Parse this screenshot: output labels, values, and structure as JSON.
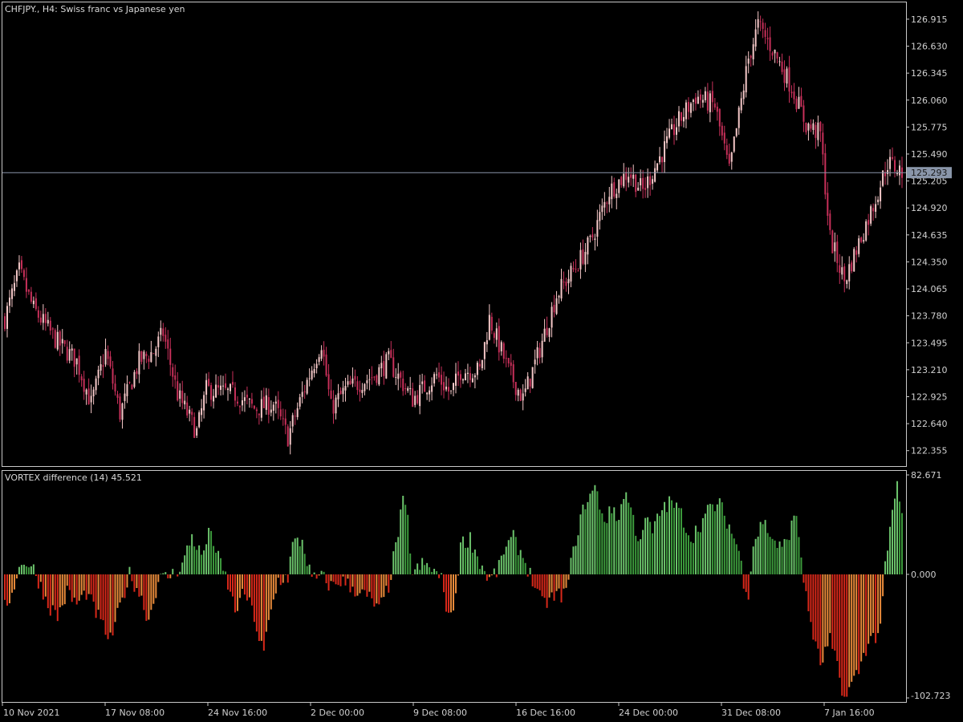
{
  "main_chart": {
    "title": "CHFJPY., H4:  Swiss franc vs Japanese yen",
    "current_price_label": "125.293",
    "current_price": 125.293,
    "price_ticks": [
      "126.915",
      "126.630",
      "126.345",
      "126.060",
      "125.775",
      "125.490",
      "125.205",
      "124.920",
      "124.635",
      "124.350",
      "124.065",
      "123.780",
      "123.495",
      "123.210",
      "122.925",
      "122.640",
      "122.355"
    ]
  },
  "indicator": {
    "title": "VORTEX difference (14) 45.521",
    "ticks": [
      "82.671",
      "0.000",
      "-102.723"
    ]
  },
  "time_axis": {
    "labels": [
      "10 Nov 2021",
      "17 Nov 08:00",
      "24 Nov 16:00",
      "2 Dec 00:00",
      "9 Dec 08:00",
      "16 Dec 16:00",
      "24 Dec 00:00",
      "31 Dec 08:00",
      "7 Jan 16:00"
    ]
  },
  "colors": {
    "background": "#000000",
    "frame": "#c8c8c8",
    "bull_candle": "#f5c8c8",
    "bear_candle": "#c8305a",
    "price_line": "#8a96aa",
    "price_label_bg": "#8a96aa",
    "vortex_pos": "#3c9a3c",
    "vortex_pos_light": "#6cc46c",
    "vortex_neg": "#d8281a",
    "vortex_neg_light": "#e88a3a"
  },
  "chart_data": [
    {
      "type": "candlestick",
      "title": "CHFJPY., H4:  Swiss franc vs Japanese yen",
      "ylim": [
        122.2,
        127.05
      ],
      "count": 150,
      "close_path": [
        [
          0,
          123.75
        ],
        [
          6,
          124.25
        ],
        [
          12,
          123.85
        ],
        [
          22,
          123.5
        ],
        [
          30,
          123.3
        ],
        [
          36,
          122.85
        ],
        [
          42,
          123.4
        ],
        [
          48,
          122.75
        ],
        [
          56,
          123.3
        ],
        [
          62,
          123.4
        ],
        [
          66,
          123.6
        ],
        [
          72,
          122.95
        ],
        [
          80,
          122.55
        ],
        [
          84,
          123.0
        ],
        [
          96,
          122.95
        ],
        [
          104,
          122.8
        ],
        [
          112,
          122.85
        ],
        [
          118,
          122.5
        ],
        [
          124,
          122.95
        ],
        [
          132,
          123.5
        ],
        [
          136,
          122.8
        ],
        [
          142,
          123.0
        ],
        [
          154,
          123.15
        ],
        [
          160,
          123.3
        ],
        [
          170,
          122.9
        ],
        [
          180,
          123.15
        ],
        [
          186,
          122.95
        ],
        [
          190,
          123.2
        ],
        [
          198,
          123.2
        ],
        [
          202,
          123.75
        ],
        [
          210,
          123.2
        ],
        [
          216,
          122.9
        ],
        [
          222,
          123.35
        ],
        [
          230,
          124.0
        ],
        [
          238,
          124.3
        ],
        [
          244,
          124.55
        ],
        [
          252,
          125.1
        ],
        [
          260,
          125.3
        ],
        [
          266,
          125.1
        ],
        [
          272,
          125.4
        ],
        [
          280,
          125.8
        ],
        [
          288,
          126.1
        ],
        [
          296,
          126.0
        ],
        [
          302,
          125.3
        ],
        [
          310,
          126.5
        ],
        [
          314,
          126.85
        ],
        [
          320,
          126.6
        ],
        [
          328,
          126.2
        ],
        [
          334,
          125.8
        ],
        [
          340,
          125.7
        ],
        [
          344,
          124.6
        ],
        [
          350,
          124.15
        ],
        [
          356,
          124.55
        ],
        [
          362,
          124.95
        ],
        [
          368,
          125.4
        ],
        [
          374,
          125.3
        ]
      ],
      "last_price": 125.293
    },
    {
      "type": "bar",
      "title": "VORTEX difference (14) 45.521",
      "ylim": [
        -102.723,
        82.671
      ],
      "count": 375,
      "values_path": [
        [
          0,
          -28
        ],
        [
          3,
          -15
        ],
        [
          5,
          0
        ],
        [
          8,
          12
        ],
        [
          12,
          4
        ],
        [
          14,
          -5
        ],
        [
          18,
          -25
        ],
        [
          22,
          -35
        ],
        [
          26,
          -15
        ],
        [
          30,
          -25
        ],
        [
          34,
          -15
        ],
        [
          40,
          -40
        ],
        [
          44,
          -55
        ],
        [
          48,
          -28
        ],
        [
          52,
          0
        ],
        [
          56,
          -15
        ],
        [
          60,
          -38
        ],
        [
          64,
          -5
        ],
        [
          70,
          0
        ],
        [
          74,
          8
        ],
        [
          78,
          32
        ],
        [
          82,
          15
        ],
        [
          86,
          38
        ],
        [
          88,
          18
        ],
        [
          92,
          -2
        ],
        [
          96,
          -30
        ],
        [
          100,
          -15
        ],
        [
          104,
          -35
        ],
        [
          106,
          -55
        ],
        [
          108,
          -65
        ],
        [
          110,
          -40
        ],
        [
          114,
          -5
        ],
        [
          118,
          -2
        ],
        [
          120,
          25
        ],
        [
          124,
          28
        ],
        [
          128,
          -5
        ],
        [
          132,
          -2
        ],
        [
          136,
          -10
        ],
        [
          140,
          -5
        ],
        [
          144,
          -10
        ],
        [
          148,
          -15
        ],
        [
          152,
          -20
        ],
        [
          156,
          -30
        ],
        [
          160,
          -10
        ],
        [
          164,
          35
        ],
        [
          166,
          60
        ],
        [
          168,
          45
        ],
        [
          170,
          0
        ],
        [
          174,
          8
        ],
        [
          178,
          5
        ],
        [
          182,
          -5
        ],
        [
          184,
          -25
        ],
        [
          186,
          -38
        ],
        [
          188,
          -15
        ],
        [
          190,
          25
        ],
        [
          194,
          30
        ],
        [
          198,
          10
        ],
        [
          202,
          -5
        ],
        [
          206,
          5
        ],
        [
          208,
          20
        ],
        [
          212,
          30
        ],
        [
          216,
          15
        ],
        [
          220,
          -5
        ],
        [
          224,
          -25
        ],
        [
          228,
          -20
        ],
        [
          234,
          -15
        ],
        [
          238,
          30
        ],
        [
          242,
          60
        ],
        [
          244,
          65
        ],
        [
          246,
          72
        ],
        [
          250,
          45
        ],
        [
          254,
          55
        ],
        [
          256,
          45
        ],
        [
          258,
          68
        ],
        [
          260,
          62
        ],
        [
          264,
          30
        ],
        [
          268,
          45
        ],
        [
          270,
          35
        ],
        [
          274,
          55
        ],
        [
          278,
          60
        ],
        [
          282,
          50
        ],
        [
          286,
          30
        ],
        [
          290,
          42
        ],
        [
          294,
          55
        ],
        [
          298,
          58
        ],
        [
          302,
          40
        ],
        [
          306,
          20
        ],
        [
          308,
          -5
        ],
        [
          310,
          -15
        ],
        [
          312,
          25
        ],
        [
          316,
          45
        ],
        [
          320,
          30
        ],
        [
          324,
          20
        ],
        [
          328,
          40
        ],
        [
          330,
          50
        ],
        [
          334,
          -20
        ],
        [
          338,
          -60
        ],
        [
          340,
          -75
        ],
        [
          344,
          -55
        ],
        [
          348,
          -85
        ],
        [
          350,
          -120
        ],
        [
          352,
          -95
        ],
        [
          356,
          -80
        ],
        [
          360,
          -55
        ],
        [
          364,
          -50
        ],
        [
          366,
          -25
        ],
        [
          367,
          5
        ],
        [
          370,
          50
        ],
        [
          372,
          75
        ],
        [
          374,
          48
        ]
      ]
    }
  ]
}
